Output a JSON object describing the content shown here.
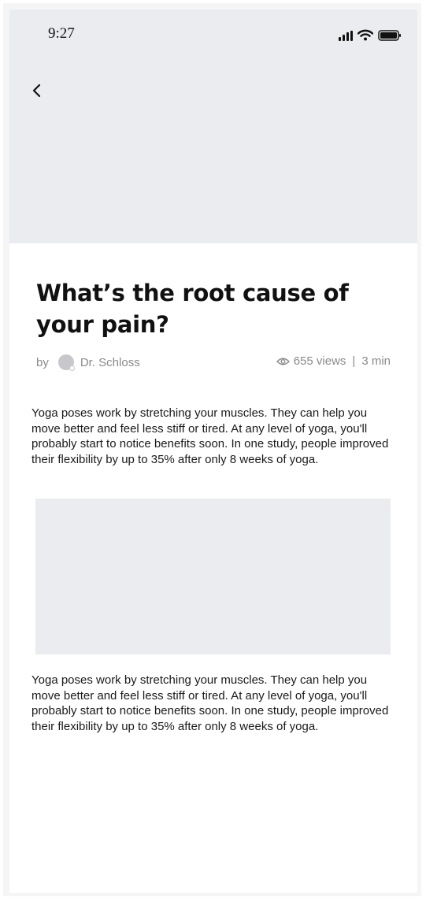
{
  "status_bar": {
    "time": "9:27",
    "icons": [
      "signal-icon",
      "wifi-icon",
      "battery-icon"
    ]
  },
  "navigation": {
    "back_icon": "chevron-left-icon"
  },
  "article": {
    "title": "What’s the root cause of your pain?",
    "by_label": "by",
    "author": "Dr. Schloss",
    "views": "655 views",
    "separator": "|",
    "read_time": "3 min",
    "paragraphs": [
      "Yoga poses work by stretching your muscles. They can help you move better and feel less stiff or tired. At any level of yoga, you'll probably start to notice benefits soon. In one study, people improved their flexibility by up to 35% after only 8 weeks of yoga.",
      "Yoga poses work by stretching your muscles. They can help you move better and feel less stiff or tired. At any level of yoga, you'll probably start to notice benefits soon. In one study, people improved their flexibility by up to 35% after only 8 weeks of yoga."
    ]
  },
  "colors": {
    "placeholder": "#ebecf0",
    "text": "#1a1a1a",
    "muted": "#8a8a8a"
  }
}
